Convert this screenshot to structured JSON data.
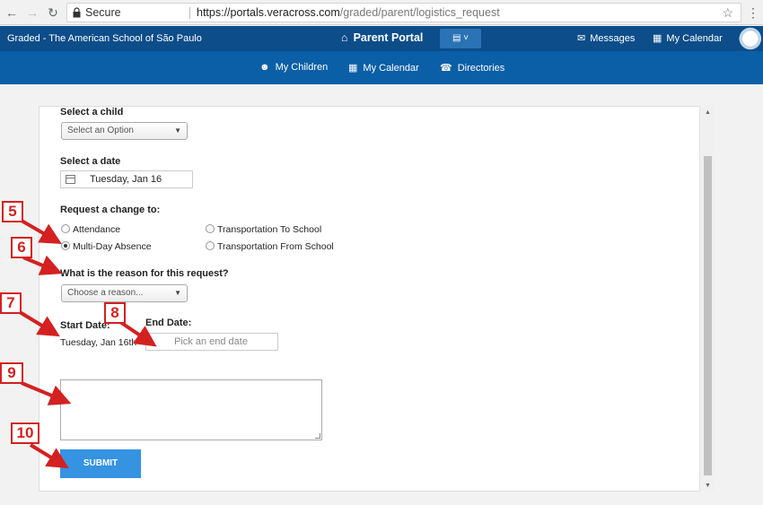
{
  "browser": {
    "secure_label": "Secure",
    "url_domain": "https://portals.veracross.com",
    "url_path": "/graded/parent/logistics_request"
  },
  "header": {
    "school_name": "Graded - The American School of São Paulo",
    "portal_title": "Parent Portal",
    "messages_label": "Messages",
    "calendar_label": "My Calendar"
  },
  "subnav": {
    "children_label": "My Children",
    "calendar_label": "My Calendar",
    "directories_label": "Directories"
  },
  "form": {
    "select_child_label": "Select a child",
    "select_child_placeholder": "Select an Option",
    "select_date_label": "Select a date",
    "select_date_value": "Tuesday, Jan 16",
    "request_change_label": "Request a change to:",
    "options": {
      "attendance": "Attendance",
      "multi_day_absence": "Multi-Day Absence",
      "transport_to": "Transportation To School",
      "transport_from": "Transportation From School",
      "selected": "Multi-Day Absence"
    },
    "reason_label": "What is the reason for this request?",
    "reason_placeholder": "Choose a reason...",
    "start_date_label": "Start Date:",
    "start_date_value": "Tuesday, Jan 16th",
    "end_date_label": "End Date:",
    "end_date_placeholder": "Pick an end date",
    "submit_label": "SUBMIT"
  },
  "annotations": {
    "m5": "5",
    "m6": "6",
    "m7": "7",
    "m8": "8",
    "m9": "9",
    "m10": "10",
    "color": "#d42020"
  },
  "colors": {
    "header_top": "#0c4d8a",
    "header_nav": "#0a5fa6",
    "submit": "#3593e2"
  }
}
